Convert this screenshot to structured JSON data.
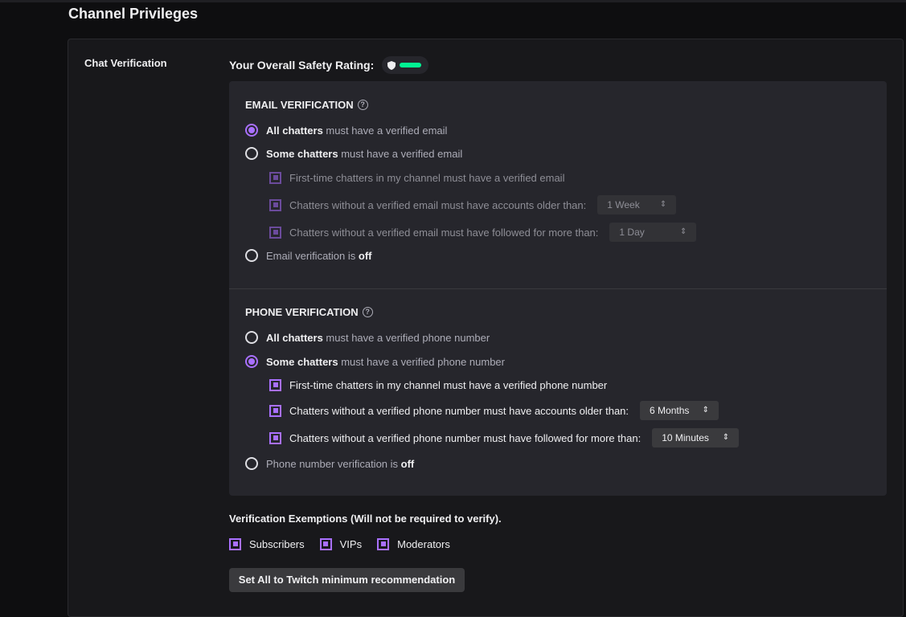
{
  "page": {
    "title": "Channel Privileges"
  },
  "chat_verification": {
    "section_label": "Chat Verification",
    "safety_rating_label": "Your Overall Safety Rating:",
    "safety_rating_icon": "shield-icon",
    "safety_rating_color": "#00f593",
    "email": {
      "heading": "EMAIL VERIFICATION",
      "help_icon": "?",
      "all_bold": "All chatters",
      "all_rest": " must have a verified email",
      "some_bold": "Some chatters",
      "some_rest": " must have a verified email",
      "first_time": "First-time chatters in my channel must have a verified email",
      "account_age": "Chatters without a verified email must have accounts older than:",
      "account_age_value": "1 Week",
      "follow_age": "Chatters without a verified email must have followed for more than:",
      "follow_age_value": "1 Day",
      "off_text": "Email verification is ",
      "off_bold": "off",
      "selected": "all"
    },
    "phone": {
      "heading": "PHONE VERIFICATION",
      "help_icon": "?",
      "all_bold": "All chatters",
      "all_rest": " must have a verified phone number",
      "some_bold": "Some chatters",
      "some_rest": " must have a verified phone number",
      "first_time": "First-time chatters in my channel must have a verified phone number",
      "account_age": "Chatters without a verified phone number must have accounts older than:",
      "account_age_value": "6 Months",
      "follow_age": "Chatters without a verified phone number must have followed for more than:",
      "follow_age_value": "10 Minutes",
      "off_text": "Phone number verification is ",
      "off_bold": "off",
      "selected": "some"
    },
    "exemptions": {
      "title": "Verification Exemptions (Will not be required to verify).",
      "items": [
        "Subscribers",
        "VIPs",
        "Moderators"
      ]
    },
    "min_button_label": "Set All to Twitch minimum recommendation"
  },
  "colors": {
    "accent": "#a970ff",
    "panel": "#18181b",
    "box": "#26262c"
  }
}
